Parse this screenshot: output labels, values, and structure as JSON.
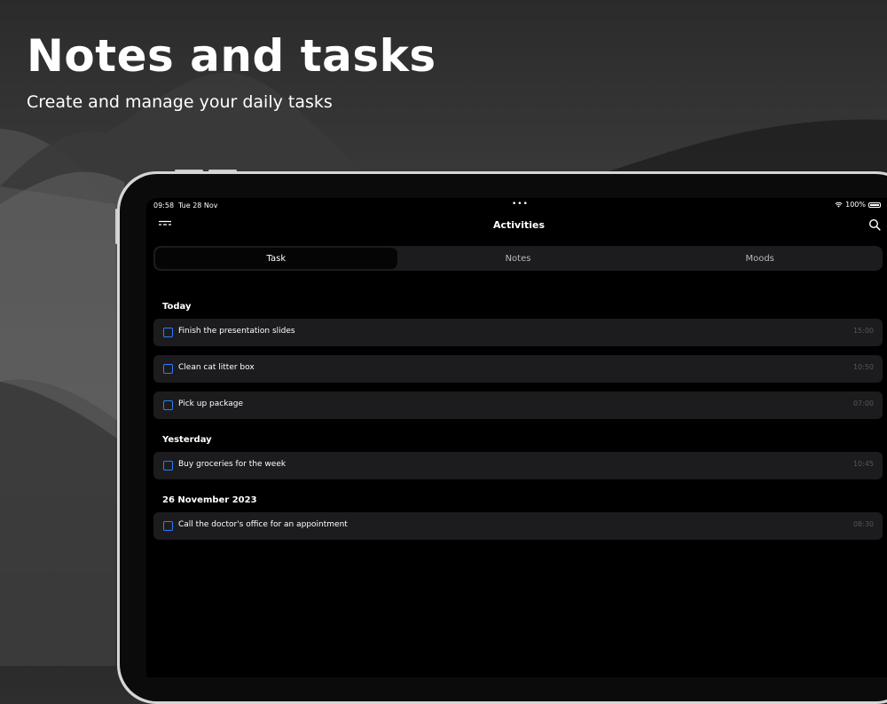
{
  "headline": "Notes and tasks",
  "subheadline": "Create and manage your daily tasks",
  "status_bar": {
    "time": "09:58",
    "date": "Tue 28 Nov",
    "dots": "•••",
    "battery": "100%"
  },
  "header": {
    "title": "Activities",
    "menu_icon": "menu-icon",
    "search_icon": "search-icon"
  },
  "tabs": [
    {
      "label": "Task",
      "active": true
    },
    {
      "label": "Notes",
      "active": false
    },
    {
      "label": "Moods",
      "active": false
    }
  ],
  "sections": [
    {
      "title": "Today",
      "tasks": [
        {
          "text": "Finish the presentation slides",
          "time": "15:00"
        },
        {
          "text": "Clean cat litter box",
          "time": "10:50"
        },
        {
          "text": "Pick up package",
          "time": "07:00"
        }
      ]
    },
    {
      "title": "Yesterday",
      "tasks": [
        {
          "text": "Buy groceries for the week",
          "time": "10:45"
        }
      ]
    },
    {
      "title": "26 November 2023",
      "tasks": [
        {
          "text": "Call the doctor's office for an appointment",
          "time": "08:30"
        }
      ]
    }
  ],
  "colors": {
    "accent": "#2f7cf6",
    "row_bg": "#1c1c1e",
    "screen_bg": "#000000"
  }
}
